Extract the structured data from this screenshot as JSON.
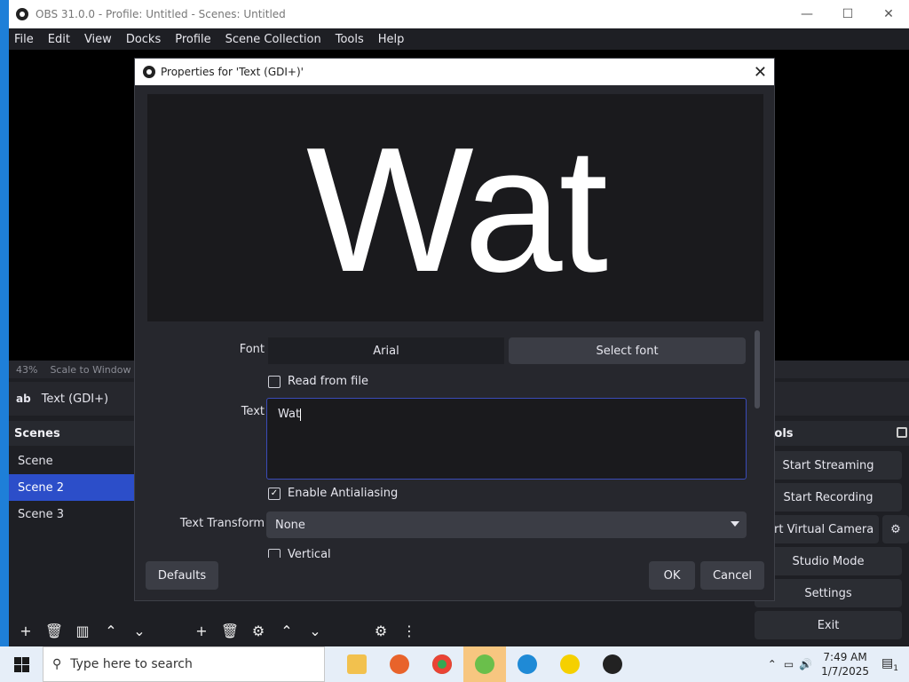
{
  "window": {
    "title": "OBS 31.0.0 - Profile: Untitled - Scenes: Untitled",
    "min": "—",
    "max": "☐",
    "close": "✕"
  },
  "menu": [
    "File",
    "Edit",
    "View",
    "Docks",
    "Profile",
    "Scene Collection",
    "Tools",
    "Help"
  ],
  "preview_status": {
    "zoom": "43%",
    "scale": "Scale to Window"
  },
  "source_toolbar": {
    "icon_text": "ab",
    "source_name": "Text (GDI+)"
  },
  "scenes_dock": {
    "title": "Scenes",
    "items": [
      "Scene",
      "Scene 2",
      "Scene 3"
    ],
    "selected_index": 1
  },
  "controls_dock": {
    "title": "rols",
    "buttons": {
      "start_streaming": "Start Streaming",
      "start_recording": "Start Recording",
      "start_virtual_camera": "rt Virtual Camera",
      "studio_mode": "Studio Mode",
      "settings": "Settings",
      "exit": "Exit"
    }
  },
  "dialog": {
    "title": "Properties for 'Text (GDI+)'",
    "close": "✕",
    "preview_text": "Wat",
    "font_label": "Font",
    "font_value": "Arial",
    "select_font": "Select font",
    "read_from_file": "Read from file",
    "read_from_file_checked": false,
    "text_label": "Text",
    "text_value": "Wat",
    "enable_antialiasing": "Enable Antialiasing",
    "enable_antialiasing_checked": true,
    "text_transform_label": "Text Transform",
    "text_transform_value": "None",
    "vertical_label": "Vertical",
    "defaults": "Defaults",
    "ok": "OK",
    "cancel": "Cancel"
  },
  "taskbar": {
    "search_placeholder": "Type here to search",
    "time": "7:49 AM",
    "date": "1/7/2025",
    "notification_count": "1"
  },
  "colors": {
    "accent": "#2c4ec9",
    "dialog_bg": "#26272d",
    "window_bg": "#1e1f24"
  }
}
